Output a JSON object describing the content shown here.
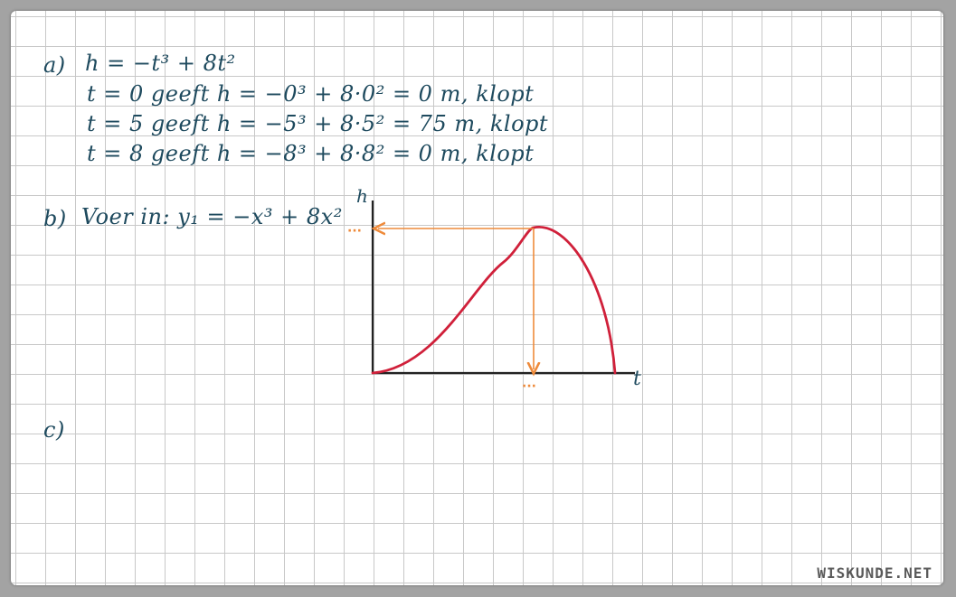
{
  "part_a": {
    "label": "a)",
    "formula": "h = −t³ + 8t²",
    "lines": [
      "t = 0  geeft  h = −0³ + 8·0² = 0 m, klopt",
      "t = 5  geeft  h = −5³ + 8·5² = 75 m, klopt",
      "t = 8  geeft  h = −8³ + 8·8² = 0 m, klopt"
    ]
  },
  "part_b": {
    "label": "b)",
    "text": "Voer in: y₁ = −x³ + 8x²"
  },
  "part_c": {
    "label": "c)"
  },
  "graph": {
    "y_axis_label": "h",
    "x_axis_label": "t",
    "y_marker": "···",
    "x_marker": "···",
    "curve_color": "#d0203a",
    "arrow_color": "#ee8a3a",
    "axis_color": "#222222"
  },
  "watermark": "WISKUNDE.NET"
}
